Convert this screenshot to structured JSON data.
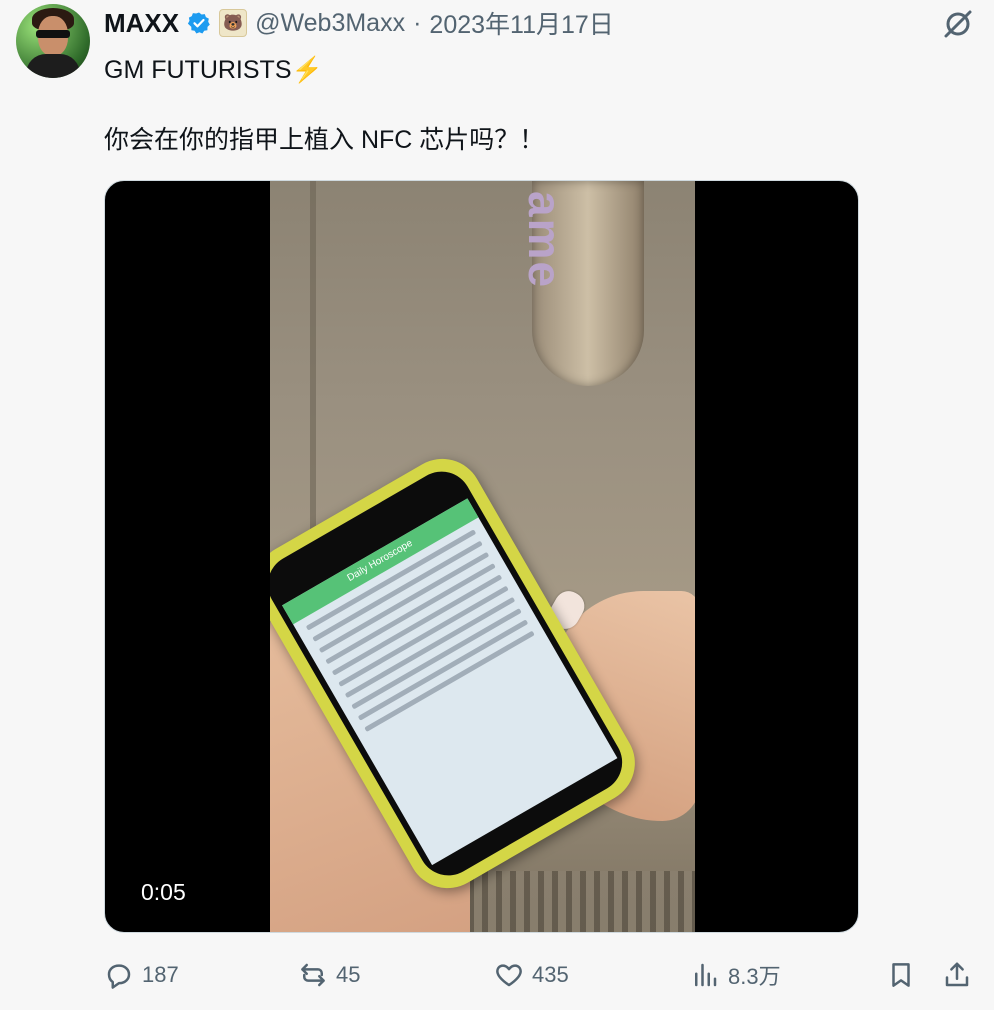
{
  "author": {
    "name": "MAXX",
    "badge_icon": "🐻",
    "handle": "@Web3Maxx",
    "separator": "·",
    "date": "2023年11月17日"
  },
  "tweet": {
    "line1": "GM FUTURISTS",
    "line1_emoji": "⚡",
    "line2": "你会在你的指甲上植入 NFC 芯片吗？！"
  },
  "media": {
    "duration": "0:05",
    "sign_text": "ame",
    "phone_header": "Daily Horoscope"
  },
  "actions": {
    "replies": "187",
    "reposts": "45",
    "likes": "435",
    "views": "8.3万"
  },
  "colors": {
    "verified": "#1d9bf0",
    "secondary_text": "#536471",
    "bolt": "#f5b120"
  }
}
